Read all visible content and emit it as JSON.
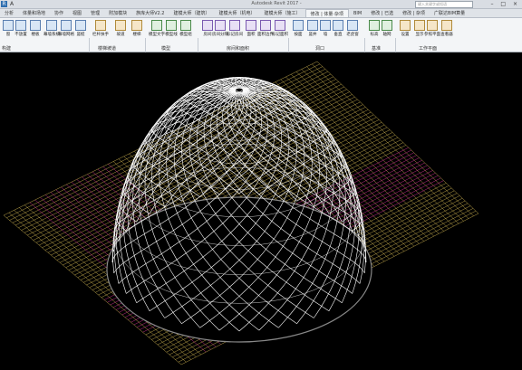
{
  "titlebar": {
    "app_icon_letter": "R",
    "quick_access": "A",
    "title": "Autodesk Revit 2017 -",
    "search_placeholder": "键入关键字或短语",
    "window_controls": "– □ ×"
  },
  "tabs": [
    {
      "label": "分析",
      "active": false
    },
    {
      "label": "体量和场地",
      "active": false
    },
    {
      "label": "协作",
      "active": false
    },
    {
      "label": "视图",
      "active": false
    },
    {
      "label": "管理",
      "active": false
    },
    {
      "label": "附加模块",
      "active": false
    },
    {
      "label": "族库大师V2.2",
      "active": false
    },
    {
      "label": "建模大师（建筑）",
      "active": false
    },
    {
      "label": "建模大师（机电）",
      "active": false
    },
    {
      "label": "建模大师（施工）",
      "active": false
    },
    {
      "label": "修改 | 体量·杂项",
      "active": true
    },
    {
      "label": "BIM",
      "active": false
    },
    {
      "label": "修改 | 已选",
      "active": false
    },
    {
      "label": "修改 | 杂项",
      "active": false
    },
    {
      "label": "广联达BIM算量",
      "active": false
    }
  ],
  "ribbon": {
    "buttons": [
      {
        "label": "窗",
        "color": "c1"
      },
      {
        "label": "不放置",
        "color": "c1"
      },
      {
        "label": "楼板",
        "color": "c1"
      },
      {
        "label": "幕墙系统",
        "color": "c1"
      },
      {
        "label": "幕墙网格",
        "color": "c1"
      },
      {
        "label": "竖梃",
        "color": "c1"
      },
      {
        "label": "栏杆扶手",
        "color": "c2"
      },
      {
        "label": "坡道",
        "color": "c2"
      },
      {
        "label": "楼梯",
        "color": "c2"
      },
      {
        "label": "模型文字",
        "color": "c3"
      },
      {
        "label": "模型线",
        "color": "c3"
      },
      {
        "label": "模型组",
        "color": "c3"
      },
      {
        "label": "房间",
        "color": "c4"
      },
      {
        "label": "房间分隔",
        "color": "c4"
      },
      {
        "label": "标记房间",
        "color": "c4"
      },
      {
        "label": "面积",
        "color": "c4"
      },
      {
        "label": "面积边界",
        "color": "c4"
      },
      {
        "label": "标记面积",
        "color": "c4"
      },
      {
        "label": "按面",
        "color": "c1"
      },
      {
        "label": "竖井",
        "color": "c1"
      },
      {
        "label": "墙",
        "color": "c1"
      },
      {
        "label": "垂直",
        "color": "c1"
      },
      {
        "label": "老虎窗",
        "color": "c1"
      },
      {
        "label": "标高",
        "color": "c3"
      },
      {
        "label": "轴网",
        "color": "c3"
      },
      {
        "label": "设置",
        "color": "c2"
      },
      {
        "label": "显示",
        "color": "c2"
      },
      {
        "label": "参照平面",
        "color": "c2"
      },
      {
        "label": "查看器",
        "color": "c2"
      }
    ],
    "panels": [
      "构建",
      "楼梯坡道",
      "模型",
      "房间和面积",
      "洞口",
      "基准",
      "工作平面"
    ]
  },
  "colors": {
    "viewport_bg": "#000000",
    "dome_lines": "#ffffff",
    "ground_lines_primary": "#b8a048",
    "ground_lines_accent": "#c02a8a"
  }
}
